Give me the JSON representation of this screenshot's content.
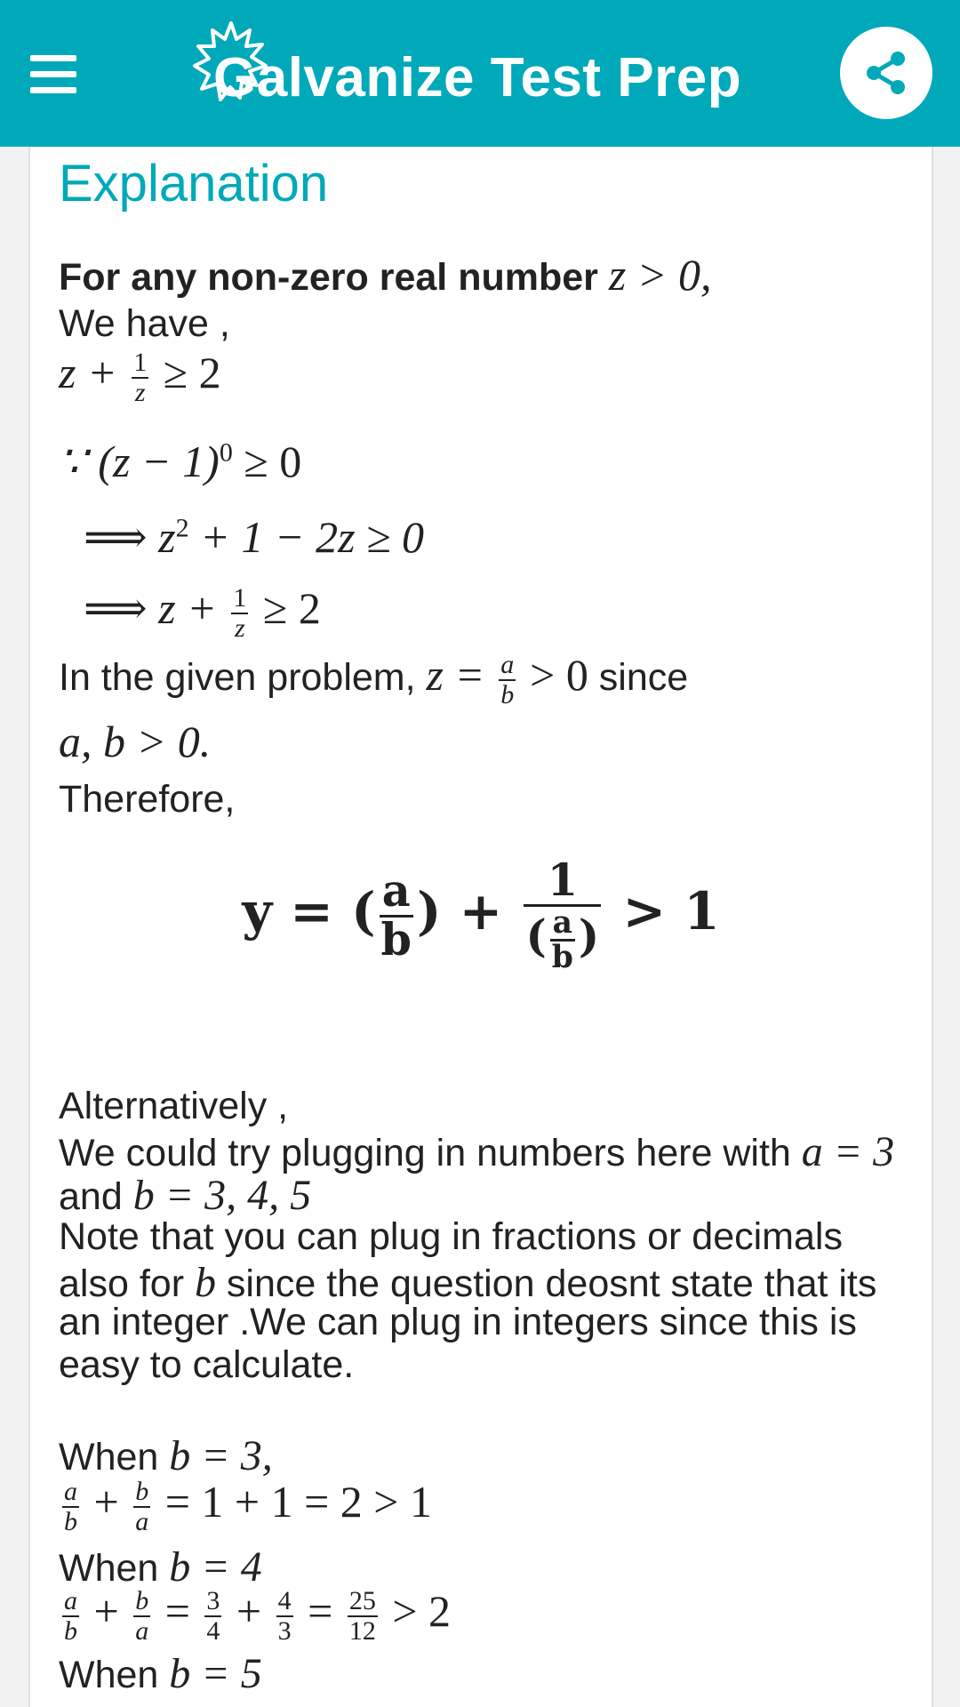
{
  "header": {
    "app_title": "Galvanize Test Prep",
    "brand_color": "#00a9b9",
    "menu_icon": "hamburger-menu-icon",
    "share_icon": "share-icon"
  },
  "content": {
    "section_title": "Explanation",
    "line_intro_text": "For any non-zero real number",
    "line_intro_math": "z > 0,",
    "we_have": "We have ,",
    "ineq_1": {
      "lhs": "z +",
      "num": "1",
      "den": "z",
      "rhs": "≥ 2"
    },
    "because": "∵ (z − 1)",
    "because_exp": "0",
    "because_rhs": "≥ 0",
    "implies_1": "⟹  z",
    "implies_1_exp": "2",
    "implies_1_rest": "+ 1 − 2z ≥ 0",
    "implies_2": {
      "lhs": "⟹  z +",
      "num": "1",
      "den": "z",
      "rhs": "≥ 2"
    },
    "given_text_1": "In the given problem,",
    "given_math_1": "z =",
    "given_num": "a",
    "given_den": "b",
    "given_math_2": "> 0",
    "given_text_2": "since",
    "given_cond": "a, b > 0.",
    "therefore": "Therefore,",
    "display": {
      "lhs": "y = (",
      "num_1": "a",
      "den_1": "b",
      "mid": ") +",
      "num_2": "1",
      "den_2_open": "(",
      "den_2_num": "a",
      "den_2_den": "b",
      "den_2_close": ")",
      "rhs": "> 1"
    },
    "alternatively": "Alternatively ,",
    "plug_text": "We could try plugging in numbers here with",
    "plug_math": "a = 3",
    "and_text": "and",
    "and_math": "b = 3, 4, 5",
    "note_1": "Note that you can plug in fractions or decimals",
    "note_2_a": "also for",
    "note_2_math": "b",
    "note_2_b": "since the question deosnt state that its",
    "note_3": "an integer .We can plug in integers since this is",
    "note_4": "easy to calculate.",
    "case_1_label": "When",
    "case_1_math": "b = 3,",
    "case_1_eq": {
      "n1": "a",
      "d1": "b",
      "plus": "+",
      "n2": "b",
      "d2": "a",
      "rest": "= 1 + 1 = 2 > 1"
    },
    "case_2_label": "When",
    "case_2_math": "b = 4",
    "case_2_eq": {
      "n1": "a",
      "d1": "b",
      "plus": "+",
      "n2": "b",
      "d2": "a",
      "eq": "=",
      "n3": "3",
      "d3": "4",
      "plus2": "+",
      "n4": "4",
      "d4": "3",
      "eq2": "=",
      "n5": "25",
      "d5": "12",
      "rest": "> 2"
    },
    "case_3_label": "When",
    "case_3_math": "b = 5"
  }
}
